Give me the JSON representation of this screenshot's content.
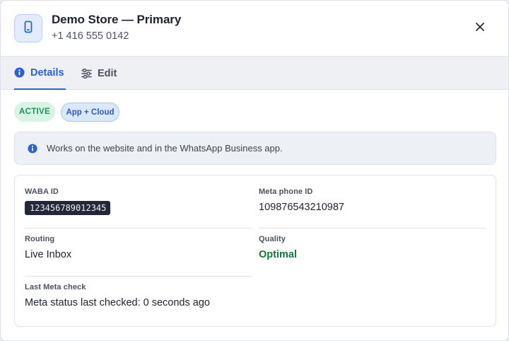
{
  "header": {
    "title": "Demo Store — Primary",
    "phone": "+1 416 555 0142"
  },
  "tabs": [
    {
      "label": "Details",
      "active": true
    },
    {
      "label": "Edit",
      "active": false
    }
  ],
  "badges": {
    "status": "ACTIVE",
    "mode": "App + Cloud"
  },
  "info": {
    "text": "Works on the website and in the WhatsApp Business app."
  },
  "fields": {
    "waba_id": {
      "label": "WABA ID",
      "value": "123456789012345"
    },
    "meta_phone_id": {
      "label": "Meta phone ID",
      "value": "109876543210987"
    },
    "routing": {
      "label": "Routing",
      "value": "Live Inbox"
    },
    "quality": {
      "label": "Quality",
      "value": "Optimal"
    },
    "last_check": {
      "label": "Last Meta check",
      "value": "Meta status last checked: 0 seconds ago"
    }
  },
  "colors": {
    "accent": "#2962d3",
    "active_green": "#17935a",
    "quality_green": "#18733c"
  },
  "icons": {
    "phone": "mobile-phone-icon",
    "close": "close-icon",
    "details_tab": "info-circle-icon",
    "edit_tab": "sliders-icon",
    "banner": "info-circle-icon"
  }
}
